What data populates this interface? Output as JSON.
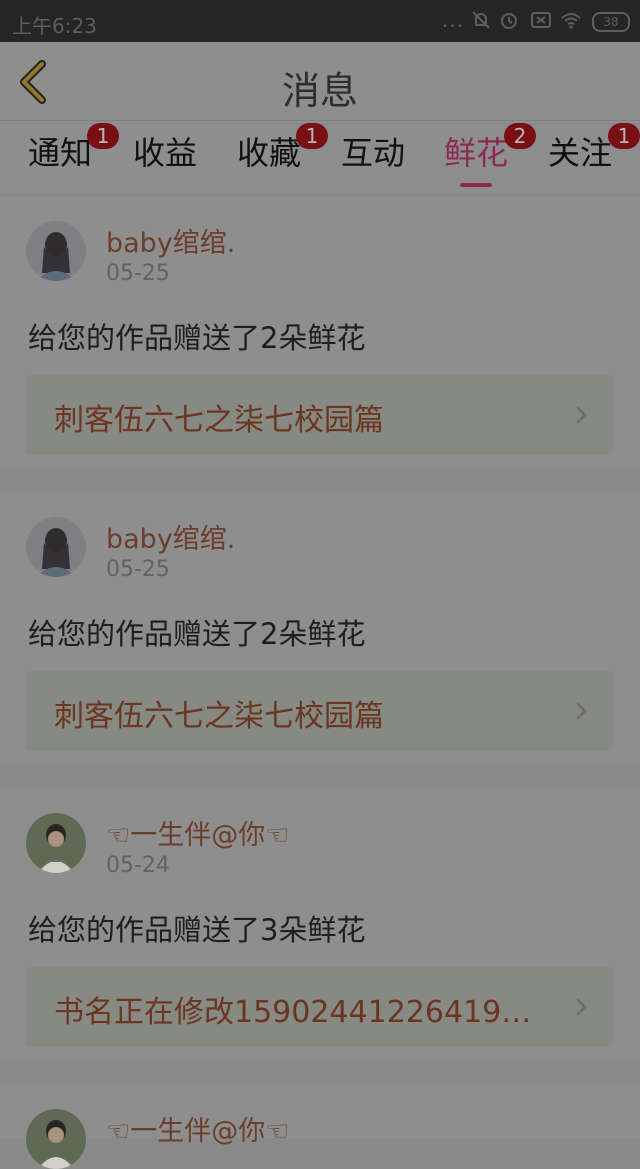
{
  "status_bar": {
    "time": "上午6:23",
    "dots": "...",
    "battery": "38"
  },
  "header": {
    "title": "消息",
    "back_icon": "chevron-left-icon"
  },
  "colors": {
    "accent": "#8a2a52",
    "badge": "#7a0f13",
    "username": "#6b3d2a"
  },
  "tabs": [
    {
      "label": "通知",
      "badge": "1",
      "active": false
    },
    {
      "label": "收益",
      "badge": "",
      "active": false
    },
    {
      "label": "收藏",
      "badge": "1",
      "active": false
    },
    {
      "label": "互动",
      "badge": "",
      "active": false
    },
    {
      "label": "鲜花",
      "badge": "2",
      "active": true
    },
    {
      "label": "关注",
      "badge": "1",
      "active": false
    }
  ],
  "messages": [
    {
      "username": "baby绾绾.",
      "date": "05-25",
      "text": "给您的作品赠送了2朵鲜花",
      "book": "刺客伍六七之柒七校园篇"
    },
    {
      "username": "baby绾绾.",
      "date": "05-25",
      "text": "给您的作品赠送了2朵鲜花",
      "book": "刺客伍六七之柒七校园篇"
    },
    {
      "username": "☜一生伴@你☜",
      "date": "05-24",
      "text": "给您的作品赠送了3朵鲜花",
      "book": "书名正在修改15902441226419…"
    },
    {
      "username": "☜一生伴@你☜",
      "date": "",
      "text": "",
      "book": ""
    }
  ]
}
